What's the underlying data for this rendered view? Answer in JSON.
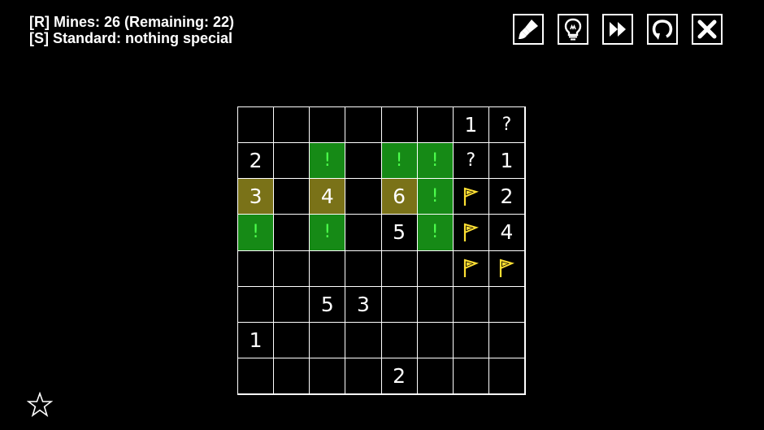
{
  "info": {
    "line1": "[R] Mines: 26 (Remaining: 22)",
    "line2": "[S] Standard: nothing special"
  },
  "toolbar": [
    {
      "name": "brush-button",
      "icon": "paintbrush-icon"
    },
    {
      "name": "hint-button",
      "icon": "lightbulb-icon"
    },
    {
      "name": "skip-button",
      "icon": "fast-forward-icon"
    },
    {
      "name": "restart-button",
      "icon": "restart-icon"
    },
    {
      "name": "close-button",
      "icon": "close-icon"
    }
  ],
  "colors": {
    "revealed_highlight": "#7a7218",
    "safe_mark": "#168a16",
    "safe_text": "#4dff4d",
    "flag": "#ffe033"
  },
  "board": {
    "rows": 8,
    "cols": 8,
    "cells": [
      [
        "",
        "",
        "",
        "",
        "",
        "",
        "1",
        "?"
      ],
      [
        "2",
        "",
        "!",
        "",
        "!",
        "!",
        "?",
        "1"
      ],
      [
        "3",
        "",
        "4",
        "",
        "6",
        "!",
        "F",
        "2"
      ],
      [
        "!",
        "",
        "!",
        "",
        "5",
        "!",
        "F",
        "4"
      ],
      [
        "",
        "",
        "",
        "",
        "",
        "",
        "F",
        "F"
      ],
      [
        "",
        "",
        "5",
        "3",
        "",
        "",
        "",
        ""
      ],
      [
        "1",
        "",
        "",
        "",
        "",
        "",
        "",
        ""
      ],
      [
        "",
        "",
        "",
        "",
        "2",
        "",
        "",
        ""
      ]
    ],
    "highlighted": [
      [
        2,
        0
      ],
      [
        2,
        2
      ],
      [
        2,
        4
      ]
    ]
  },
  "favorite": {
    "icon": "star-icon"
  }
}
